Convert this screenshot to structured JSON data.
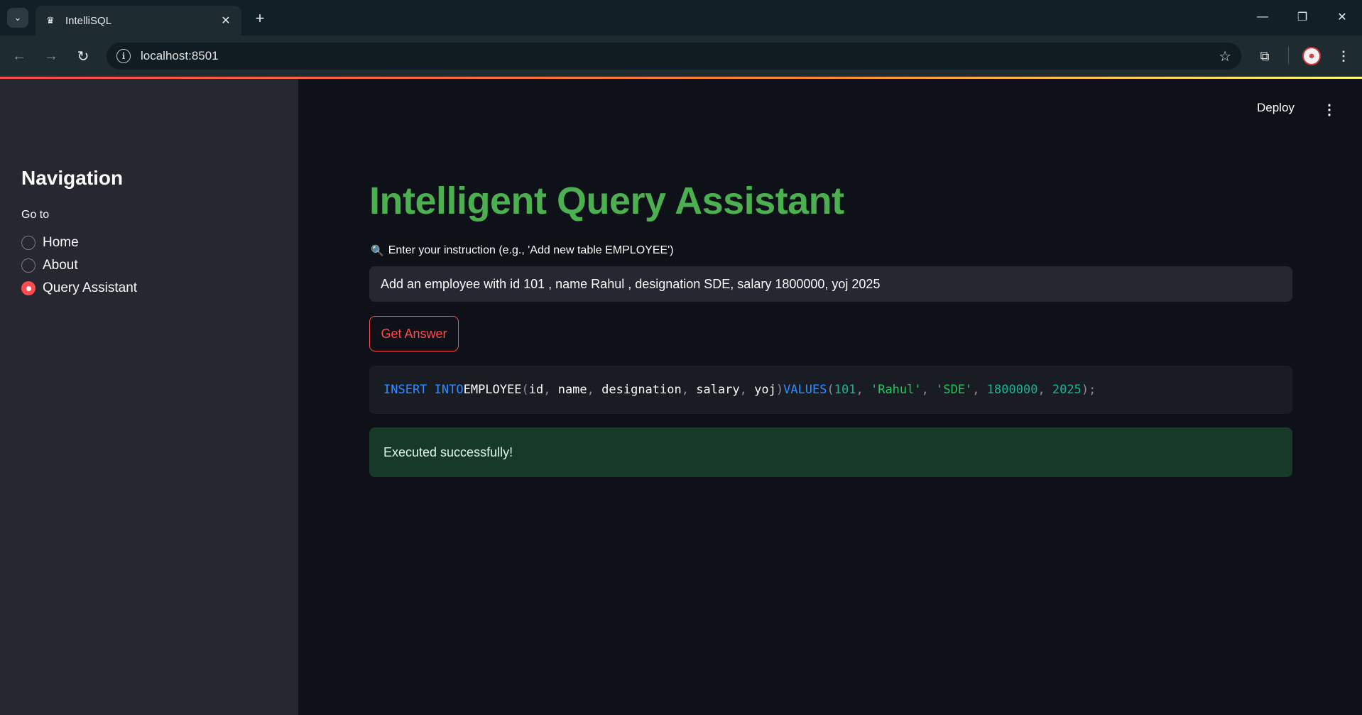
{
  "browser": {
    "tab_title": "IntelliSQL",
    "url": "localhost:8501"
  },
  "sidebar": {
    "title": "Navigation",
    "radio_label": "Go to",
    "options": [
      {
        "label": "Home",
        "selected": false
      },
      {
        "label": "About",
        "selected": false
      },
      {
        "label": "Query Assistant",
        "selected": true
      }
    ]
  },
  "header": {
    "deploy_label": "Deploy"
  },
  "main": {
    "title": "Intelligent Query Assistant",
    "input_label": "Enter your instruction (e.g., 'Add new table EMPLOYEE')",
    "input_value": "Add an employee with id 101 , name Rahul , designation SDE, salary 1800000, yoj 2025",
    "button_label": "Get Answer",
    "sql_tokens": {
      "kw1": "INSERT INTO",
      "table": "EMPLOYEE",
      "p_open": "(",
      "c1": "id",
      "c2": "name",
      "c3": "designation",
      "c4": "salary",
      "c5": "yoj",
      "p_close": ")",
      "kw2": "VALUES",
      "v1": "101",
      "v2": "'Rahul'",
      "v3": "'SDE'",
      "v4": "1800000",
      "v5": "2025",
      "end": ");"
    },
    "success_message": "Executed successfully!"
  },
  "colors": {
    "title_green": "#4caf50",
    "accent_red": "#ff4b4b",
    "success_bg": "#173928"
  }
}
